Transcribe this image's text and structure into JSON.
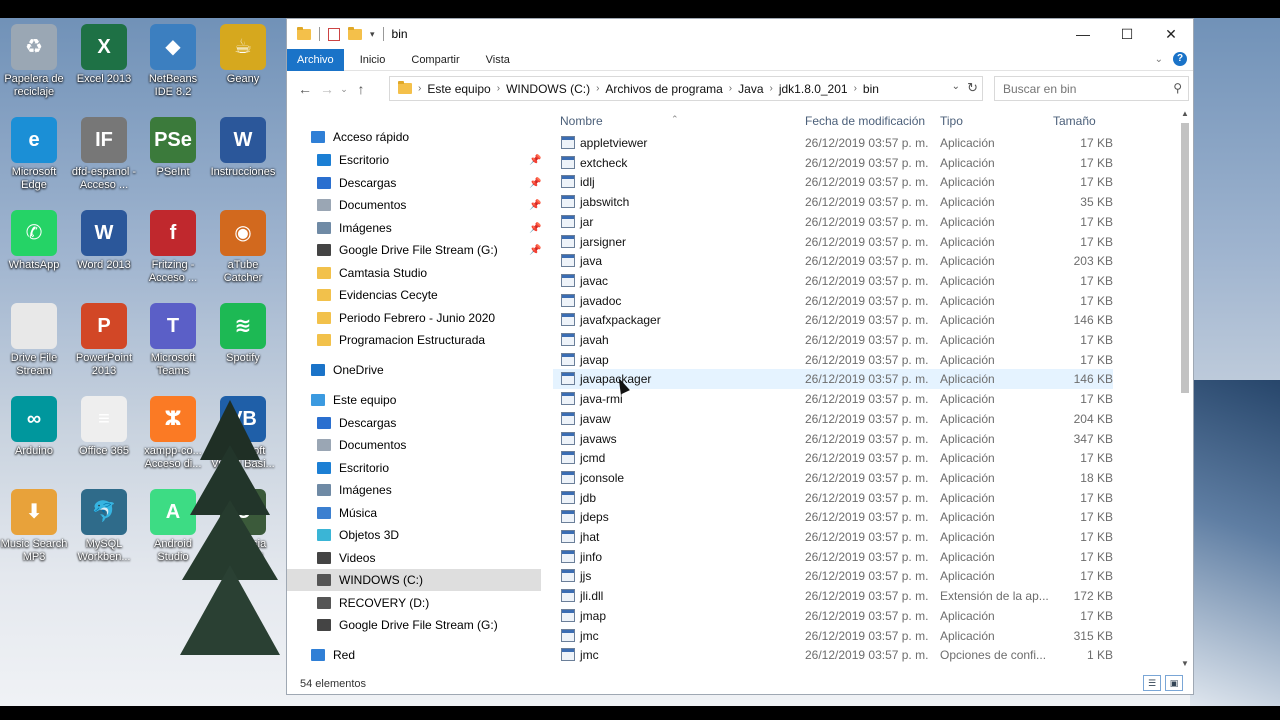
{
  "desktop": {
    "icons": [
      {
        "label": "Papelera de reciclaje",
        "icon": "recycle-bin-icon",
        "color": "#9aa7b4",
        "glyph": "♻"
      },
      {
        "label": "Excel 2013",
        "icon": "excel-icon",
        "color": "#1e7145",
        "glyph": "X"
      },
      {
        "label": "NetBeans IDE 8.2",
        "icon": "netbeans-icon",
        "color": "#3c7fc0",
        "glyph": "◆"
      },
      {
        "label": "Geany",
        "icon": "geany-icon",
        "color": "#d6a81e",
        "glyph": "☕"
      },
      {
        "label": "Microsoft Edge",
        "icon": "edge-icon",
        "color": "#1b8fd6",
        "glyph": "e"
      },
      {
        "label": "dfd-espanol - Acceso ...",
        "icon": "dfd-icon",
        "color": "#777777",
        "glyph": "IF"
      },
      {
        "label": "PSeInt",
        "icon": "pseint-icon",
        "color": "#3b7a3b",
        "glyph": "PSe"
      },
      {
        "label": "Instrucciones",
        "icon": "word-doc-icon",
        "color": "#2b579a",
        "glyph": "W"
      },
      {
        "label": "WhatsApp",
        "icon": "whatsapp-icon",
        "color": "#25d366",
        "glyph": "✆"
      },
      {
        "label": "Word 2013",
        "icon": "word-icon",
        "color": "#2b579a",
        "glyph": "W"
      },
      {
        "label": "Fritzing - Acceso ...",
        "icon": "fritzing-icon",
        "color": "#c0282d",
        "glyph": "f"
      },
      {
        "label": "aTube Catcher",
        "icon": "atube-icon",
        "color": "#d2691e",
        "glyph": "◉"
      },
      {
        "label": "Drive File Stream",
        "icon": "drive-file-icon",
        "color": "#e8e8e8",
        "glyph": ""
      },
      {
        "label": "PowerPoint 2013",
        "icon": "powerpoint-icon",
        "color": "#d24726",
        "glyph": "P"
      },
      {
        "label": "Microsoft Teams",
        "icon": "teams-icon",
        "color": "#5b5fc7",
        "glyph": "T"
      },
      {
        "label": "Spotify",
        "icon": "spotify-icon",
        "color": "#1db954",
        "glyph": "≋"
      },
      {
        "label": "Arduino",
        "icon": "arduino-icon",
        "color": "#00979d",
        "glyph": "∞"
      },
      {
        "label": "Office 365",
        "icon": "office-doc-icon",
        "color": "#eeeeee",
        "glyph": "≡"
      },
      {
        "label": "xampp-co... Acceso di...",
        "icon": "xampp-icon",
        "color": "#fb7a24",
        "glyph": "ⵣ"
      },
      {
        "label": "Microsoft Visual Basi...",
        "icon": "visual-basic-icon",
        "color": "#1f5fa8",
        "glyph": "VB"
      },
      {
        "label": "Music Search MP3",
        "icon": "music-search-icon",
        "color": "#e8a23a",
        "glyph": "⬇"
      },
      {
        "label": "MySQL Workben...",
        "icon": "mysql-icon",
        "color": "#2f6b8a",
        "glyph": "🐬"
      },
      {
        "label": "Android Studio",
        "icon": "android-studio-icon",
        "color": "#3ddc84",
        "glyph": "A"
      },
      {
        "label": "Camtasia Studio 8",
        "icon": "camtasia-icon",
        "color": "#3b5a3a",
        "glyph": "C"
      }
    ]
  },
  "window": {
    "title": "bin",
    "controls": {
      "minimize": "—",
      "maximize": "☐",
      "close": "✕"
    },
    "ribbon_tabs": [
      "Archivo",
      "Inicio",
      "Compartir",
      "Vista"
    ],
    "help": "?",
    "breadcrumb": [
      "Este equipo",
      "WINDOWS (C:)",
      "Archivos de programa",
      "Java",
      "jdk1.8.0_201",
      "bin"
    ],
    "search_placeholder": "Buscar en bin",
    "columns": {
      "name": "Nombre",
      "date": "Fecha de modificación",
      "type": "Tipo",
      "size": "Tamaño"
    },
    "nav": [
      {
        "label": "Acceso rápido",
        "icon": "star-icon",
        "color": "#2f7fd6",
        "indent": 0,
        "pinned": false
      },
      {
        "label": "Escritorio",
        "icon": "desktop-folder-icon",
        "color": "#1c7fd4",
        "indent": 1,
        "pinned": true
      },
      {
        "label": "Descargas",
        "icon": "download-arrow-icon",
        "color": "#2a6fcf",
        "indent": 1,
        "pinned": true
      },
      {
        "label": "Documentos",
        "icon": "documents-icon",
        "color": "#9aa6b4",
        "indent": 1,
        "pinned": true
      },
      {
        "label": "Imágenes",
        "icon": "pictures-icon",
        "color": "#6f8aa5",
        "indent": 1,
        "pinned": true
      },
      {
        "label": "Google Drive File Stream (G:)",
        "icon": "drive-icon",
        "color": "#444444",
        "indent": 1,
        "pinned": true
      },
      {
        "label": "Camtasia Studio",
        "icon": "folder-icon",
        "color": "#f2c14b",
        "indent": 1,
        "pinned": false
      },
      {
        "label": "Evidencias Cecyte",
        "icon": "folder-icon",
        "color": "#f2c14b",
        "indent": 1,
        "pinned": false
      },
      {
        "label": "Periodo Febrero - Junio 2020",
        "icon": "folder-icon",
        "color": "#f2c14b",
        "indent": 1,
        "pinned": false
      },
      {
        "label": "Programacion Estructurada",
        "icon": "folder-icon",
        "color": "#f2c14b",
        "indent": 1,
        "pinned": false
      },
      {
        "label": "OneDrive",
        "icon": "cloud-icon",
        "color": "#1a73c8",
        "indent": 0,
        "pinned": false
      },
      {
        "label": "Este equipo",
        "icon": "computer-icon",
        "color": "#3b9ae0",
        "indent": 0,
        "pinned": false
      },
      {
        "label": "Descargas",
        "icon": "download-arrow-icon",
        "color": "#2a6fcf",
        "indent": 1,
        "pinned": false
      },
      {
        "label": "Documentos",
        "icon": "documents-icon",
        "color": "#9aa6b4",
        "indent": 1,
        "pinned": false
      },
      {
        "label": "Escritorio",
        "icon": "desktop-folder-icon",
        "color": "#1c7fd4",
        "indent": 1,
        "pinned": false
      },
      {
        "label": "Imágenes",
        "icon": "pictures-icon",
        "color": "#6f8aa5",
        "indent": 1,
        "pinned": false
      },
      {
        "label": "Música",
        "icon": "music-note-icon",
        "color": "#3b7fd0",
        "indent": 1,
        "pinned": false
      },
      {
        "label": "Objetos 3D",
        "icon": "cube-icon",
        "color": "#3ab5d6",
        "indent": 1,
        "pinned": false
      },
      {
        "label": "Videos",
        "icon": "video-icon",
        "color": "#444444",
        "indent": 1,
        "pinned": false
      },
      {
        "label": "WINDOWS (C:)",
        "icon": "drive-icon",
        "color": "#555555",
        "indent": 1,
        "pinned": false,
        "selected": true
      },
      {
        "label": "RECOVERY (D:)",
        "icon": "drive-icon",
        "color": "#555555",
        "indent": 1,
        "pinned": false
      },
      {
        "label": "Google Drive File Stream (G:)",
        "icon": "drive-icon",
        "color": "#444444",
        "indent": 1,
        "pinned": false
      },
      {
        "label": "Red",
        "icon": "network-icon",
        "color": "#2f7fd6",
        "indent": 0,
        "pinned": false
      }
    ],
    "files": [
      {
        "name": "appletviewer",
        "date": "26/12/2019 03:57 p. m.",
        "type": "Aplicación",
        "size": "17 KB"
      },
      {
        "name": "extcheck",
        "date": "26/12/2019 03:57 p. m.",
        "type": "Aplicación",
        "size": "17 KB"
      },
      {
        "name": "idlj",
        "date": "26/12/2019 03:57 p. m.",
        "type": "Aplicación",
        "size": "17 KB"
      },
      {
        "name": "jabswitch",
        "date": "26/12/2019 03:57 p. m.",
        "type": "Aplicación",
        "size": "35 KB"
      },
      {
        "name": "jar",
        "date": "26/12/2019 03:57 p. m.",
        "type": "Aplicación",
        "size": "17 KB"
      },
      {
        "name": "jarsigner",
        "date": "26/12/2019 03:57 p. m.",
        "type": "Aplicación",
        "size": "17 KB"
      },
      {
        "name": "java",
        "date": "26/12/2019 03:57 p. m.",
        "type": "Aplicación",
        "size": "203 KB"
      },
      {
        "name": "javac",
        "date": "26/12/2019 03:57 p. m.",
        "type": "Aplicación",
        "size": "17 KB"
      },
      {
        "name": "javadoc",
        "date": "26/12/2019 03:57 p. m.",
        "type": "Aplicación",
        "size": "17 KB"
      },
      {
        "name": "javafxpackager",
        "date": "26/12/2019 03:57 p. m.",
        "type": "Aplicación",
        "size": "146 KB"
      },
      {
        "name": "javah",
        "date": "26/12/2019 03:57 p. m.",
        "type": "Aplicación",
        "size": "17 KB"
      },
      {
        "name": "javap",
        "date": "26/12/2019 03:57 p. m.",
        "type": "Aplicación",
        "size": "17 KB"
      },
      {
        "name": "javapackager",
        "date": "26/12/2019 03:57 p. m.",
        "type": "Aplicación",
        "size": "146 KB",
        "hover": true
      },
      {
        "name": "java-rmi",
        "date": "26/12/2019 03:57 p. m.",
        "type": "Aplicación",
        "size": "17 KB"
      },
      {
        "name": "javaw",
        "date": "26/12/2019 03:57 p. m.",
        "type": "Aplicación",
        "size": "204 KB"
      },
      {
        "name": "javaws",
        "date": "26/12/2019 03:57 p. m.",
        "type": "Aplicación",
        "size": "347 KB"
      },
      {
        "name": "jcmd",
        "date": "26/12/2019 03:57 p. m.",
        "type": "Aplicación",
        "size": "17 KB"
      },
      {
        "name": "jconsole",
        "date": "26/12/2019 03:57 p. m.",
        "type": "Aplicación",
        "size": "18 KB"
      },
      {
        "name": "jdb",
        "date": "26/12/2019 03:57 p. m.",
        "type": "Aplicación",
        "size": "17 KB"
      },
      {
        "name": "jdeps",
        "date": "26/12/2019 03:57 p. m.",
        "type": "Aplicación",
        "size": "17 KB"
      },
      {
        "name": "jhat",
        "date": "26/12/2019 03:57 p. m.",
        "type": "Aplicación",
        "size": "17 KB"
      },
      {
        "name": "jinfo",
        "date": "26/12/2019 03:57 p. m.",
        "type": "Aplicación",
        "size": "17 KB"
      },
      {
        "name": "jjs",
        "date": "26/12/2019 03:57 p. m.",
        "type": "Aplicación",
        "size": "17 KB"
      },
      {
        "name": "jli.dll",
        "date": "26/12/2019 03:57 p. m.",
        "type": "Extensión de la ap...",
        "size": "172 KB"
      },
      {
        "name": "jmap",
        "date": "26/12/2019 03:57 p. m.",
        "type": "Aplicación",
        "size": "17 KB"
      },
      {
        "name": "jmc",
        "date": "26/12/2019 03:57 p. m.",
        "type": "Aplicación",
        "size": "315 KB"
      },
      {
        "name": "jmc",
        "date": "26/12/2019 03:57 p. m.",
        "type": "Opciones de confi...",
        "size": "1 KB"
      }
    ],
    "status": "54 elementos"
  }
}
